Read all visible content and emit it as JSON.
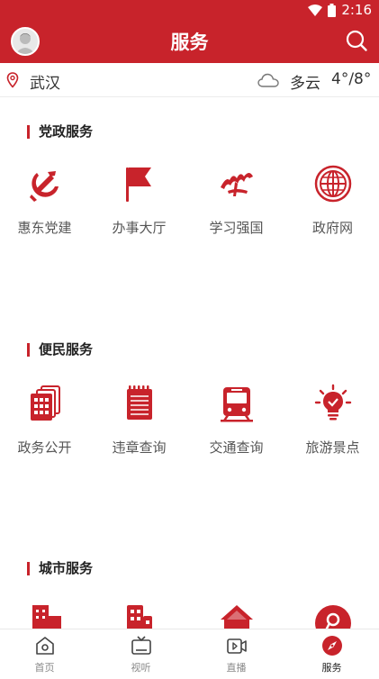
{
  "status": {
    "time": "2:16"
  },
  "header": {
    "title": "服务"
  },
  "location": {
    "city": "武汉",
    "weather": "多云",
    "temperature": "4°/8°"
  },
  "sections": [
    {
      "title": "党政服务",
      "items": [
        {
          "label": "惠东党建",
          "icon": "party-emblem-icon"
        },
        {
          "label": "办事大厅",
          "icon": "flag-icon"
        },
        {
          "label": "学习强国",
          "icon": "xuexi-logo-icon"
        },
        {
          "label": "政府网",
          "icon": "globe-icon"
        }
      ]
    },
    {
      "title": "便民服务",
      "items": [
        {
          "label": "政务公开",
          "icon": "building-cards-icon"
        },
        {
          "label": "违章查询",
          "icon": "notepad-icon"
        },
        {
          "label": "交通查询",
          "icon": "train-icon"
        },
        {
          "label": "旅游景点",
          "icon": "lightbulb-icon"
        }
      ]
    },
    {
      "title": "城市服务",
      "items": [
        {
          "label": "",
          "icon": "city-building-icon"
        },
        {
          "label": "",
          "icon": "apartment-icon"
        },
        {
          "label": "",
          "icon": "house-icon"
        },
        {
          "label": "",
          "icon": "location-badge-icon"
        }
      ]
    }
  ],
  "tabs": [
    {
      "label": "首页",
      "icon": "home-icon"
    },
    {
      "label": "视听",
      "icon": "tv-icon"
    },
    {
      "label": "直播",
      "icon": "video-icon"
    },
    {
      "label": "服务",
      "icon": "compass-icon"
    }
  ],
  "colors": {
    "brand": "#c8232b"
  }
}
